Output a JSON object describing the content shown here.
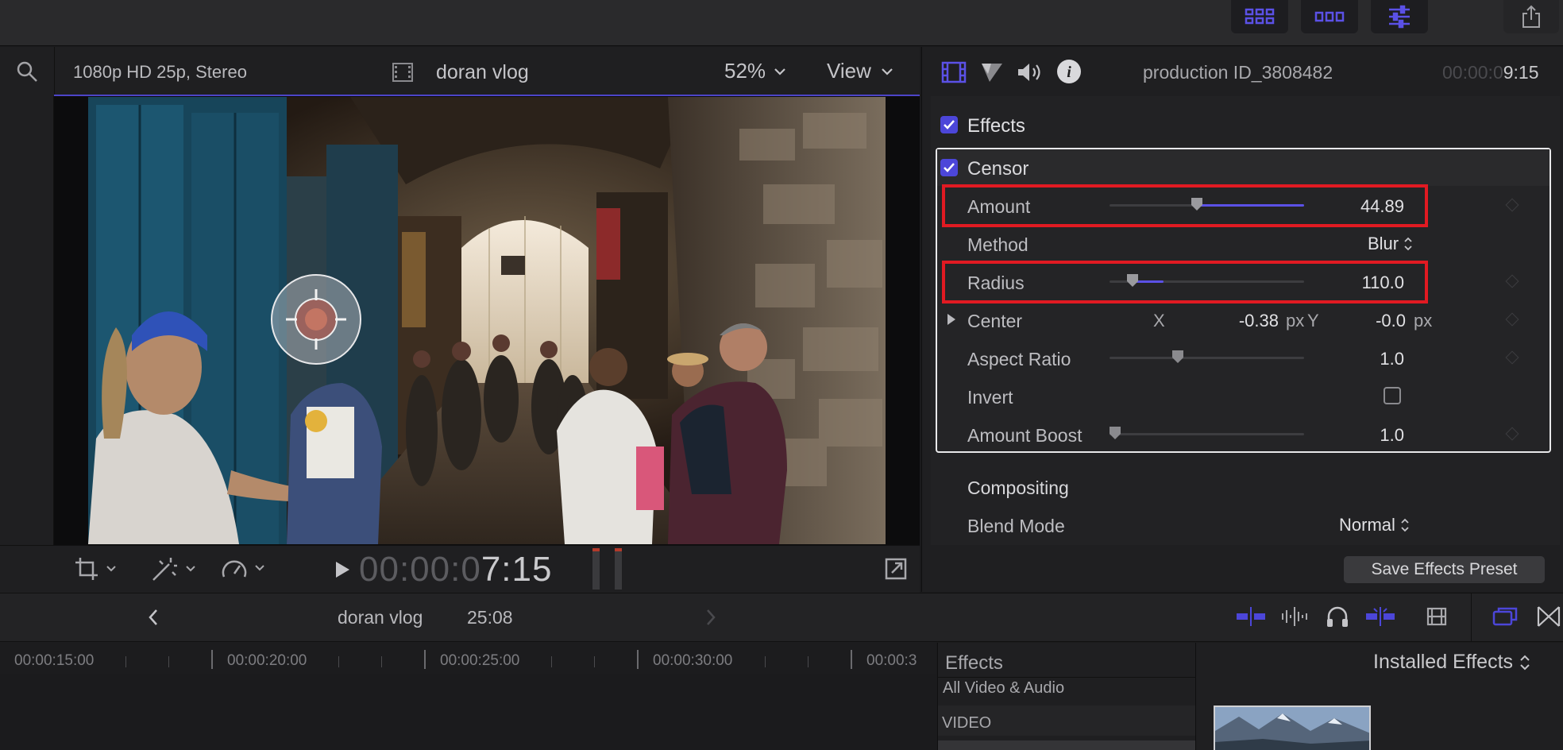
{
  "viewer": {
    "format": "1080p HD 25p, Stereo",
    "project_name": "doran vlog",
    "zoom": "52%",
    "view_label": "View",
    "timecode_dim": "00:00:0",
    "timecode_bright": "7:15"
  },
  "inspector": {
    "clip_name": "production ID_3808482",
    "duration_dim": "00:00:0",
    "duration_bright": "9:15",
    "effects_heading": "Effects",
    "censor": {
      "title": "Censor",
      "amount_label": "Amount",
      "amount_value": "44.89",
      "amount_fraction": 0.45,
      "method_label": "Method",
      "method_value": "Blur",
      "radius_label": "Radius",
      "radius_value": "110.0",
      "radius_fraction": 0.12,
      "center_label": "Center",
      "center_x_label": "X",
      "center_x_value": "-0.38",
      "center_x_unit": "px",
      "center_y_label": "Y",
      "center_y_value": "-0.0",
      "center_y_unit": "px",
      "aspect_label": "Aspect Ratio",
      "aspect_value": "1.0",
      "aspect_fraction": 0.35,
      "invert_label": "Invert",
      "boost_label": "Amount Boost",
      "boost_value": "1.0",
      "boost_fraction": 0.03
    },
    "compositing_heading": "Compositing",
    "blend_label": "Blend Mode",
    "blend_value": "Normal",
    "save_preset": "Save Effects Preset"
  },
  "timeline": {
    "project_name": "doran vlog",
    "duration": "25:08",
    "ruler": [
      "00:00:15:00",
      "00:00:20:00",
      "00:00:25:00",
      "00:00:30:00",
      "00:00:3"
    ]
  },
  "effects_browser": {
    "heading": "Effects",
    "installed": "Installed Effects",
    "all_item": "All Video & Audio",
    "video_item": "VIDEO"
  },
  "colors": {
    "accent": "#5b51e6",
    "highlight": "#e11a22"
  }
}
